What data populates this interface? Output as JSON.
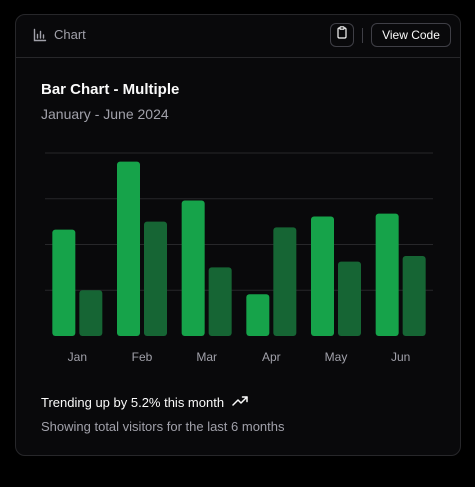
{
  "header": {
    "label": "Chart",
    "view_code_label": "View Code"
  },
  "card": {
    "title": "Bar Chart - Multiple",
    "subtitle": "January - June 2024"
  },
  "footer": {
    "trend_text": "Trending up by 5.2% this month",
    "description": "Showing total visitors for the last 6 months"
  },
  "colors": {
    "series_primary": "#16a34a",
    "series_secondary": "#166534",
    "grid": "#27272a"
  },
  "icons": {
    "chart": "bar-chart-icon",
    "copy": "clipboard-icon",
    "trend": "trending-up-icon"
  },
  "chart_data": {
    "type": "bar",
    "categories": [
      "Jan",
      "Feb",
      "Mar",
      "Apr",
      "May",
      "Jun"
    ],
    "series": [
      {
        "values": [
          186,
          305,
          237,
          73,
          209,
          214
        ]
      },
      {
        "values": [
          80,
          200,
          120,
          190,
          130,
          140
        ]
      }
    ],
    "ylim": [
      0,
      320
    ],
    "grid": true,
    "title": "Bar Chart - Multiple",
    "subtitle": "January - June 2024"
  }
}
